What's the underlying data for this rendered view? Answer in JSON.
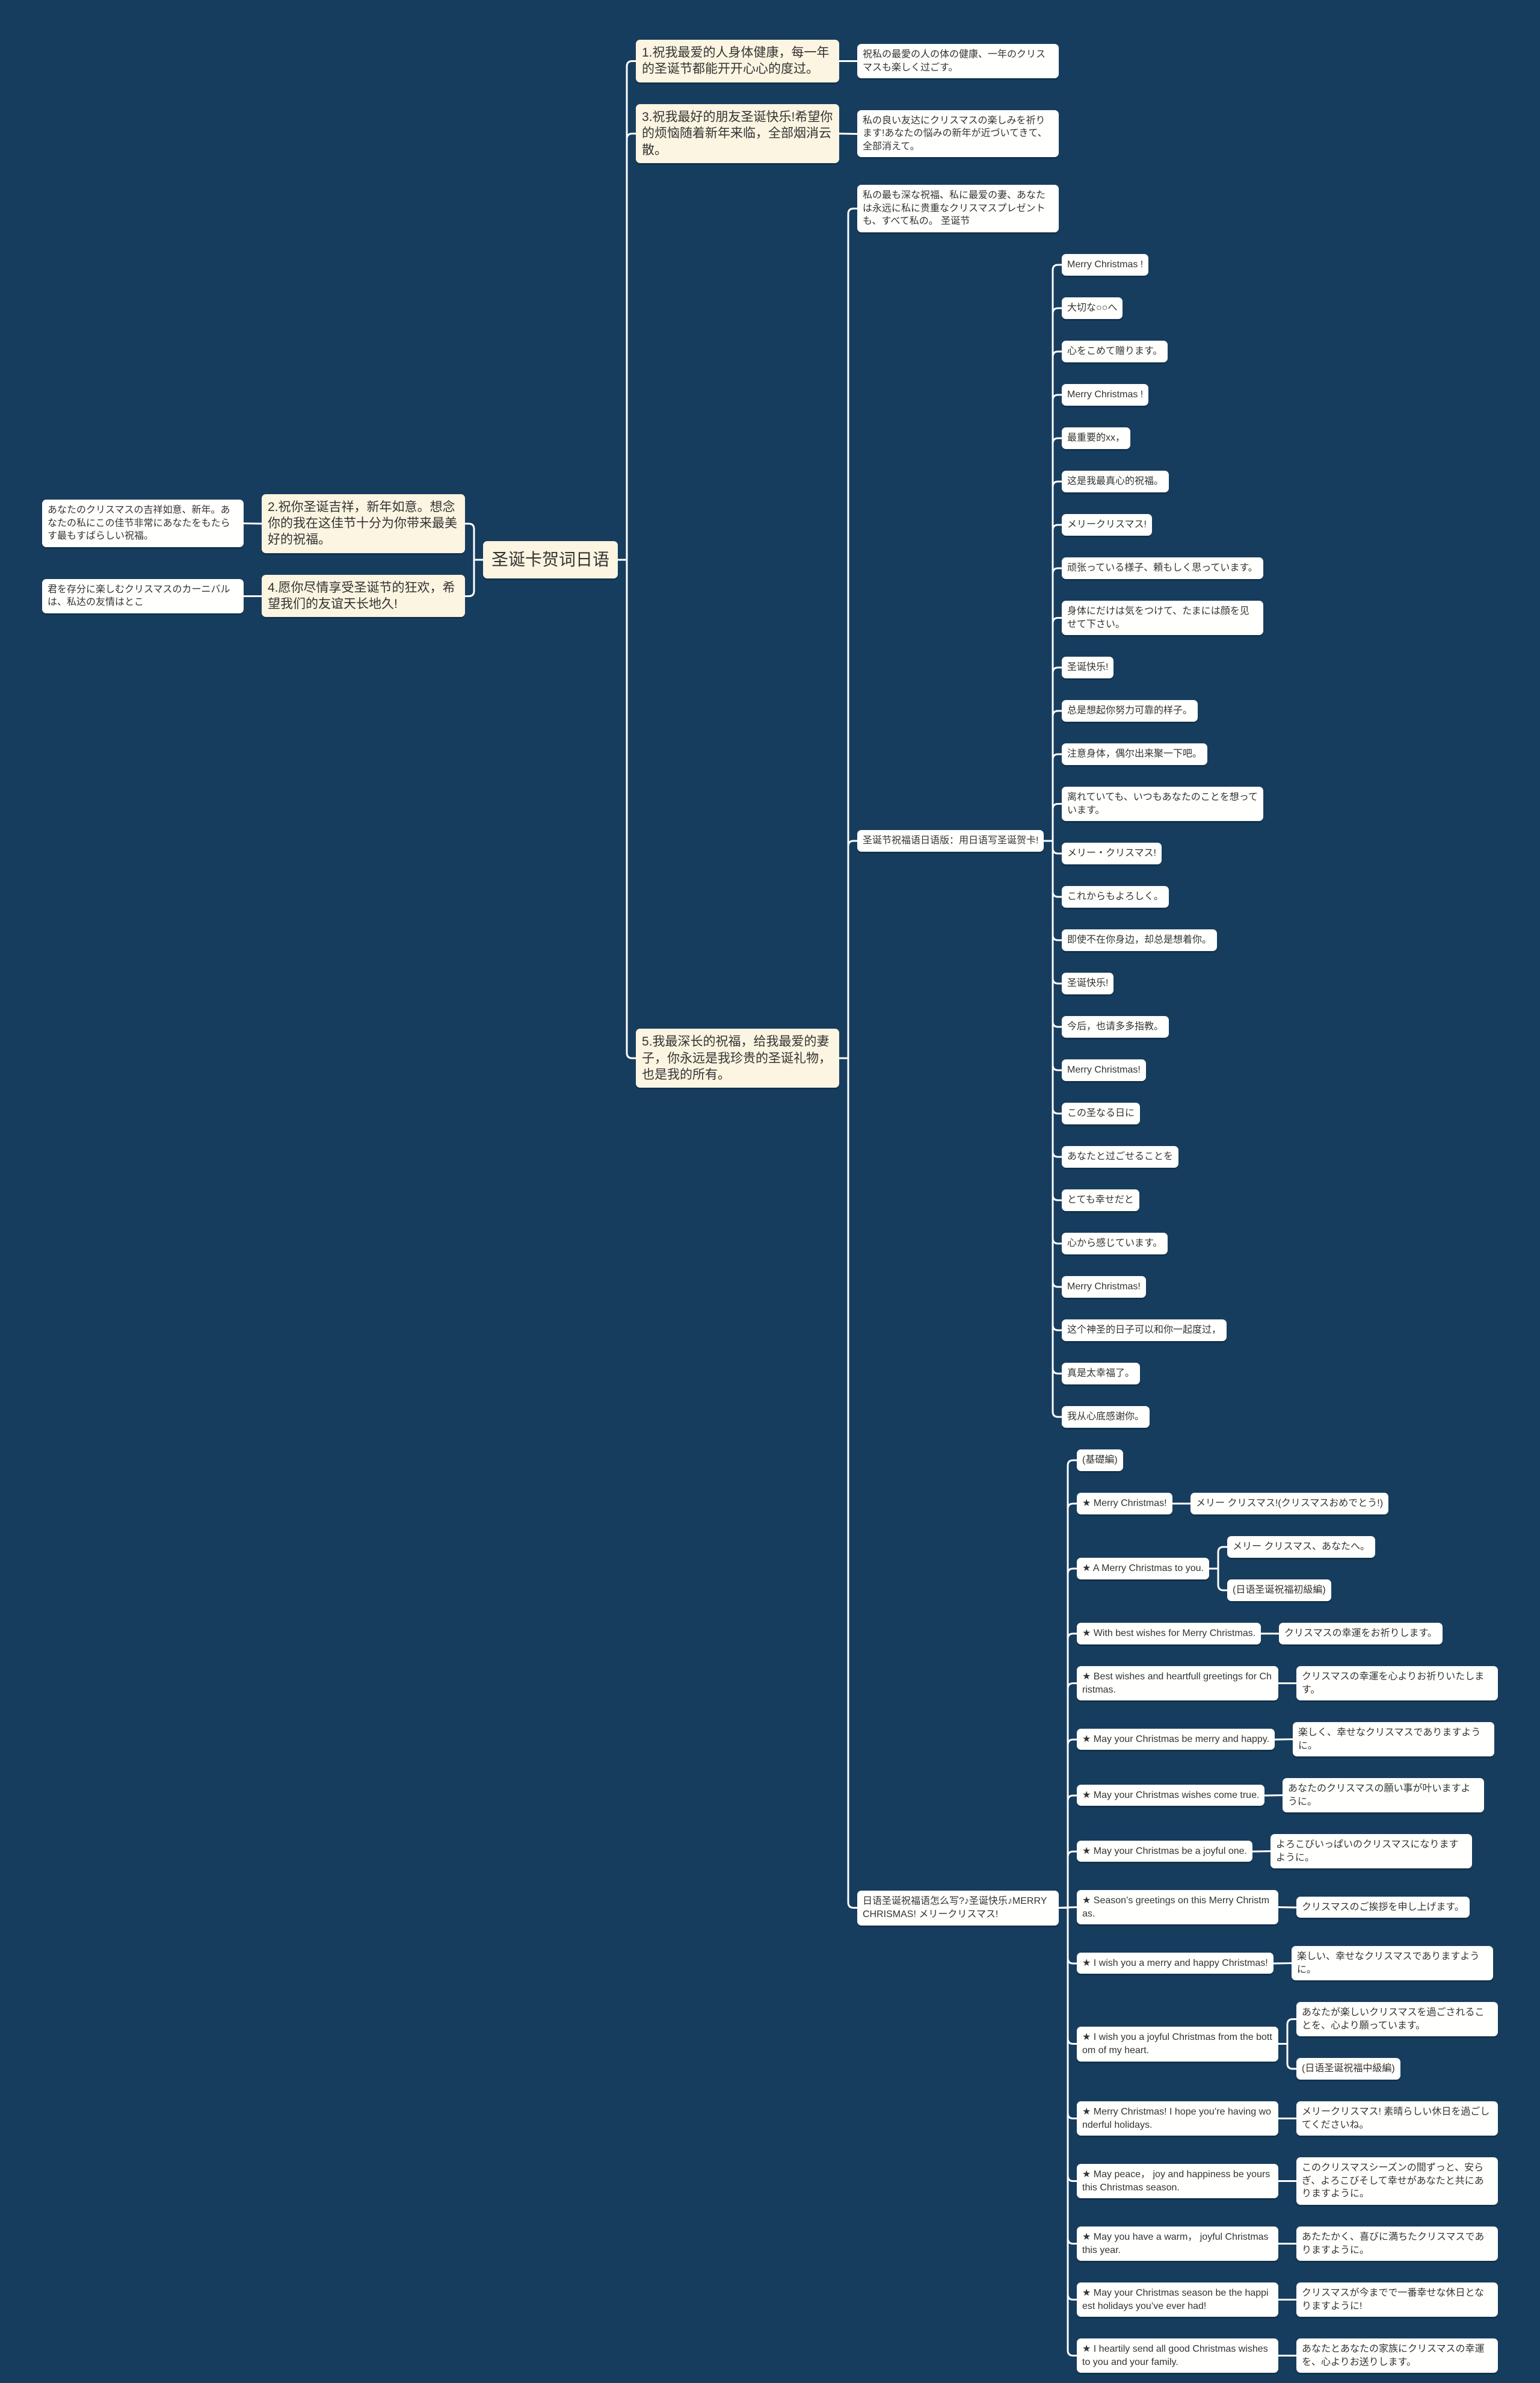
{
  "colors": {
    "background": "#173d5e",
    "topic": "#fbf5e1",
    "leaf": "#fffffd",
    "connector": "#ffffff"
  },
  "mindmap": {
    "root": {
      "text": "圣诞卡贺词日语"
    },
    "right": [
      {
        "text": "1.祝我最爱的人身体健康，每一年的圣诞节都能开开心心的度过。",
        "children": [
          {
            "text": "祝私の最愛の人の体の健康、一年のクリスマスも楽しく过ごす。"
          }
        ]
      },
      {
        "text": "3.祝我最好的朋友圣诞快乐!希望你的烦恼随着新年来临，全部烟消云散。",
        "children": [
          {
            "text": "私の良い友达にクリスマスの楽しみを祈ります!あなたの悩みの新年が近づいてきて、全部消えて。"
          }
        ]
      },
      {
        "text": "5.我最深长的祝福，给我最爱的妻子，你永远是我珍贵的圣诞礼物，也是我的所有。",
        "children": [
          {
            "text": "私の最も深な祝福、私に最爱の妻、あなたは永远に私に贵重なクリスマスプレゼントも、すべて私の。 圣诞节"
          },
          {
            "text": "圣诞节祝福语日语版：用日语写圣诞贺卡!",
            "children": [
              {
                "text": "Merry Christmas !"
              },
              {
                "text": "大切な○○へ"
              },
              {
                "text": "心をこめて贈ります。"
              },
              {
                "text": "Merry Christmas !"
              },
              {
                "text": "最重要的xx，"
              },
              {
                "text": "这是我最真心的祝福。"
              },
              {
                "text": "メリークリスマス!"
              },
              {
                "text": "顽张っている様子、頼もしく思っています。"
              },
              {
                "text": "身体にだけは気をつけて、たまには顔を见せて下さい。"
              },
              {
                "text": "圣诞快乐!"
              },
              {
                "text": "总是想起你努力可靠的样子。"
              },
              {
                "text": "注意身体，偶尔出来聚一下吧。"
              },
              {
                "text": "离れていても、いつもあなたのことを想っています。"
              },
              {
                "text": "メリー・クリスマス!"
              },
              {
                "text": "これからもよろしく。"
              },
              {
                "text": "即使不在你身边，却总是想着你。"
              },
              {
                "text": "圣诞快乐!"
              },
              {
                "text": "今后，也请多多指教。"
              },
              {
                "text": "Merry Christmas!"
              },
              {
                "text": "この圣なる日に"
              },
              {
                "text": "あなたと过ごせることを"
              },
              {
                "text": "とても幸せだと"
              },
              {
                "text": "心から感じています。"
              },
              {
                "text": "Merry Christmas!"
              },
              {
                "text": "这个神圣的日子可以和你一起度过，"
              },
              {
                "text": "真是太幸福了。"
              },
              {
                "text": "我从心底感谢你。"
              }
            ]
          },
          {
            "text": "日语圣诞祝福语怎么写?♪圣诞快乐♪MERRY CHRISMAS! メリークリスマス!",
            "children": [
              {
                "text": "(基礎編)"
              },
              {
                "text": "★ Merry Christmas!",
                "children": [
                  {
                    "text": "メリー クリスマス!(クリスマスおめでとう!)"
                  }
                ]
              },
              {
                "text": "★ A Merry Christmas to you.",
                "children": [
                  {
                    "text": "メリー クリスマス、あなたへ。"
                  },
                  {
                    "text": "(日语圣诞祝福初級編)"
                  }
                ]
              },
              {
                "text": "★ With best wishes for Merry Christmas.",
                "children": [
                  {
                    "text": "クリスマスの幸運をお祈りします。"
                  }
                ]
              },
              {
                "text": "★ Best wishes and heartfull greetings for Christmas.",
                "children": [
                  {
                    "text": "クリスマスの幸運を心よりお祈りいたします。"
                  }
                ]
              },
              {
                "text": "★ May your Christmas be merry and happy.",
                "children": [
                  {
                    "text": "楽しく、幸せなクリスマスでありますように。"
                  }
                ]
              },
              {
                "text": "★ May your Christmas wishes come true.",
                "children": [
                  {
                    "text": "あなたのクリスマスの願い事が叶いますように。"
                  }
                ]
              },
              {
                "text": "★ May your Christmas be a joyful one.",
                "children": [
                  {
                    "text": "よろこびいっぱいのクリスマスになりますように。"
                  }
                ]
              },
              {
                "text": "★ Season’s greetings on this Merry Christmas.",
                "children": [
                  {
                    "text": "クリスマスのご挨拶を申し上げます。"
                  }
                ]
              },
              {
                "text": "★ I wish you a merry and happy Christmas!",
                "children": [
                  {
                    "text": "楽しい、幸せなクリスマスでありますように。"
                  }
                ]
              },
              {
                "text": "★ I wish you a joyful Christmas from the bottom of my heart.",
                "children": [
                  {
                    "text": "あなたが楽しいクリスマスを過ごされることを、心より願っています。"
                  },
                  {
                    "text": "(日语圣诞祝福中級編)"
                  }
                ]
              },
              {
                "text": "★ Merry Christmas! I hope you’re having wonderful holidays.",
                "children": [
                  {
                    "text": "メリークリスマス! 素晴らしい休日を過ごしてくださいね。"
                  }
                ]
              },
              {
                "text": "★ May peace， joy and happiness be yours this Christmas season.",
                "children": [
                  {
                    "text": "このクリスマスシーズンの間ずっと、安らぎ、よろこびそして幸せがあなたと共にありますように。"
                  }
                ]
              },
              {
                "text": "★ May you have a warm， joyful Christmas this year.",
                "children": [
                  {
                    "text": "あたたかく、喜びに満ちたクリスマスでありますように。"
                  }
                ]
              },
              {
                "text": "★ May your Christmas season be the happiest holidays you’ve ever had!",
                "children": [
                  {
                    "text": "クリスマスが今までで一番幸せな休日となりますように!"
                  }
                ]
              },
              {
                "text": "★ I heartily send all good Christmas wishes to you and your family.",
                "children": [
                  {
                    "text": "あなたとあなたの家族にクリスマスの幸運を、心よりお送りします。"
                  }
                ]
              }
            ]
          }
        ]
      }
    ],
    "left": [
      {
        "text": "2.祝你圣诞吉祥，新年如意。想念你的我在这佳节十分为你带来最美好的祝福。",
        "children": [
          {
            "text": "あなたのクリスマスの吉祥如意、新年。あなたの私にこの佳节非常にあなたをもたらす最もすばらしい祝福。"
          }
        ]
      },
      {
        "text": "4.愿你尽情享受圣诞节的狂欢，希望我们的友谊天长地久!",
        "children": [
          {
            "text": "君を存分に楽しむクリスマスのカーニバルは、私达の友情はとこ"
          }
        ]
      }
    ]
  }
}
